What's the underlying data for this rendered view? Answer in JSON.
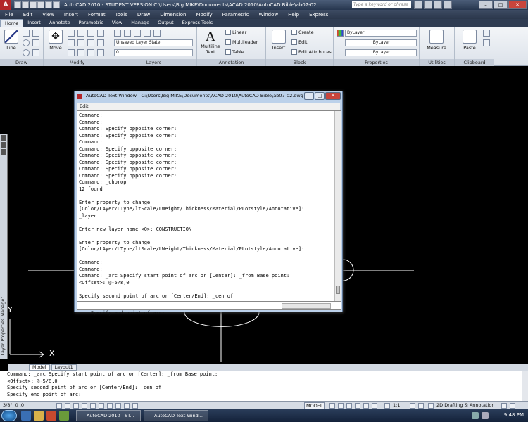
{
  "app": {
    "title": "AutoCAD 2010 - STUDENT VERSION       C:\\Users\\Big MIKE\\Documents\\ACAD 2010\\AutoCAD Bible\\ab07-02.dwg",
    "search_placeholder": "Type a keyword or phrase"
  },
  "menu": [
    "File",
    "Edit",
    "View",
    "Insert",
    "Format",
    "Tools",
    "Draw",
    "Dimension",
    "Modify",
    "Parametric",
    "Window",
    "Help",
    "Express"
  ],
  "ribbon_tabs": [
    "Home",
    "Insert",
    "Annotate",
    "Parametric",
    "View",
    "Manage",
    "Output",
    "Express Tools"
  ],
  "ribbon": {
    "draw": {
      "label": "Draw",
      "line": "Line"
    },
    "modify": {
      "label": "Modify",
      "move": "Move"
    },
    "layers": {
      "label": "Layers",
      "state": "Unsaved Layer State",
      "current": "0"
    },
    "annotation": {
      "label": "Annotation",
      "text": "Multiline\nText",
      "linear": "Linear",
      "multileader": "Multileader",
      "table": "Table"
    },
    "block": {
      "label": "Block",
      "insert": "Insert",
      "create": "Create",
      "edit": "Edit",
      "edit_attributes": "Edit Attributes"
    },
    "properties": {
      "label": "Properties",
      "color": "ByLayer",
      "linetype": "ByLayer",
      "lineweight": "ByLayer"
    },
    "utilities": {
      "label": "Utilities",
      "measure": "Measure"
    },
    "clipboard": {
      "label": "Clipboard",
      "paste": "Paste"
    }
  },
  "palette_title": "Layer Properties Manager",
  "layout_tabs": [
    "Model",
    "Layout1"
  ],
  "command_window": {
    "lines": [
      "Command: _arc Specify start point of arc or [Center]: _from Base point:",
      "<Offset>: @-5/8,0",
      "Specify second point of arc or [Center/End]: _cen of",
      "Specify end point of arc:"
    ]
  },
  "status": {
    "coords": "3/8\",  0    ,0",
    "model": "MODEL",
    "scale": "1:1",
    "workspace": "2D Drafting & Annotation"
  },
  "taskbar": {
    "task1": "AutoCAD 2010 - ST...",
    "task2": "AutoCAD Text Wind...",
    "clock": "9:48 PM"
  },
  "text_window": {
    "title": "AutoCAD Text Window - C:\\Users\\Big MIKE\\Documents\\ACAD 2010\\AutoCAD Bible\\ab07-02.dwg",
    "menu": "Edit",
    "lines": [
      "Command:",
      "Command:",
      "Command: Specify opposite corner:",
      "Command: Specify opposite corner:",
      "Command:",
      "Command: Specify opposite corner:",
      "Command: Specify opposite corner:",
      "Command: Specify opposite corner:",
      "Command: Specify opposite corner:",
      "Command: Specify opposite corner:",
      "Command: _chprop",
      "12 found",
      "",
      "Enter property to change",
      "[Color/LAyer/LType/ltScale/LWeight/Thickness/Material/PLotstyle/Annotative]:",
      "_layer",
      "",
      "Enter new layer name <0>: CONSTRUCTION",
      "",
      "Enter property to change",
      "[Color/LAyer/LType/ltScale/LWeight/Thickness/Material/PLotstyle/Annotative]:",
      "",
      "Command:",
      "Command:",
      "Command: _arc Specify start point of arc or [Center]: _from Base point:",
      "<Offset>: @-5/8,0",
      "",
      "Specify second point of arc or [Center/End]: _cen of"
    ],
    "input": "Specify end point of arc: "
  },
  "ucs": {
    "x": "X",
    "y": "Y"
  }
}
